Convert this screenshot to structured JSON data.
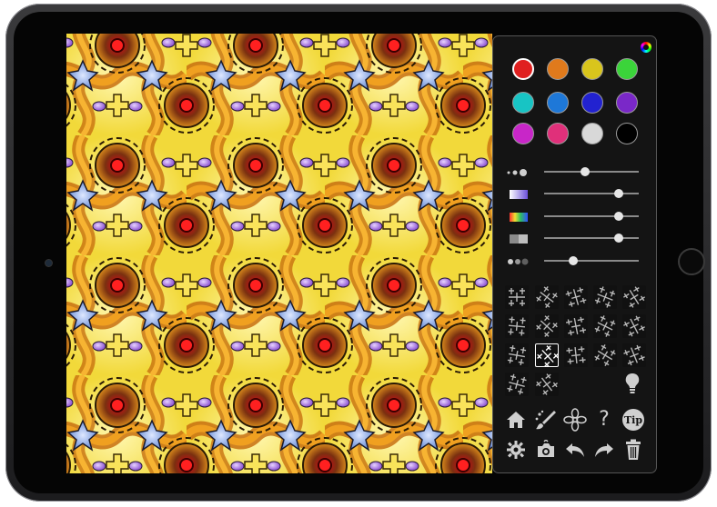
{
  "device": {
    "name": "iPad"
  },
  "palette": {
    "colors": [
      {
        "name": "red",
        "hex": "#e02020",
        "selected": true
      },
      {
        "name": "orange",
        "hex": "#e07a1c",
        "selected": false
      },
      {
        "name": "yellow",
        "hex": "#d9c51c",
        "selected": false
      },
      {
        "name": "green",
        "hex": "#3bd43a",
        "selected": false
      },
      {
        "name": "cyan",
        "hex": "#18c4c4",
        "selected": false
      },
      {
        "name": "blue",
        "hex": "#1e78d8",
        "selected": false
      },
      {
        "name": "navy",
        "hex": "#2222d0",
        "selected": false
      },
      {
        "name": "purple",
        "hex": "#7a28c8",
        "selected": false
      },
      {
        "name": "magenta",
        "hex": "#c826c8",
        "selected": false
      },
      {
        "name": "pink",
        "hex": "#e0307a",
        "selected": false
      },
      {
        "name": "light-gray",
        "hex": "#d8d8d8",
        "selected": false
      },
      {
        "name": "black",
        "hex": "#000000",
        "selected": false
      }
    ]
  },
  "sliders": [
    {
      "name": "brush-size",
      "icon": "brush-size-icon",
      "level": 0.43
    },
    {
      "name": "color-gradient",
      "icon": "gradient-icon",
      "level": 0.79
    },
    {
      "name": "rainbow",
      "icon": "rainbow-icon",
      "level": 0.79
    },
    {
      "name": "opacity",
      "icon": "opacity-icon",
      "level": 0.79
    },
    {
      "name": "blur",
      "icon": "blur-icon",
      "level": 0.31
    }
  ],
  "patterns": {
    "count": 17,
    "selected_index": 11
  },
  "toolbar": {
    "row1": [
      "home-icon",
      "brush-icon",
      "flower-icon",
      "help-icon",
      "tip-icon"
    ],
    "row2": [
      "settings-icon",
      "camera-icon",
      "undo-icon",
      "redo-icon",
      "trash-icon"
    ],
    "help_label": "?",
    "tip_label": "Tip"
  },
  "accent_colors": {
    "canvas_base": "#f4e34a",
    "panel_bg": "#141414"
  }
}
